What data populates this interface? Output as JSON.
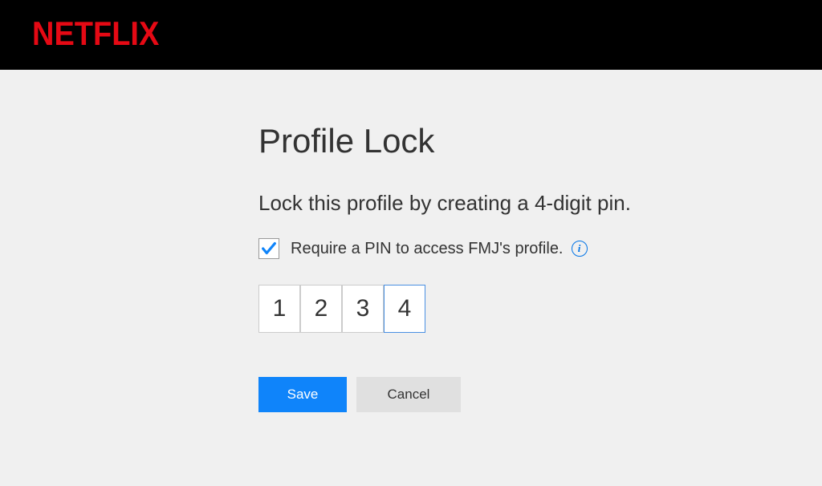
{
  "header": {
    "logo_text": "NETFLIX"
  },
  "main": {
    "title": "Profile Lock",
    "subtitle": "Lock this profile by creating a 4-digit pin.",
    "checkbox": {
      "checked": true,
      "label": "Require a PIN to access FMJ's profile."
    },
    "pin": {
      "digits": [
        "1",
        "2",
        "3",
        "4"
      ],
      "active_index": 3
    },
    "buttons": {
      "save_label": "Save",
      "cancel_label": "Cancel"
    }
  }
}
